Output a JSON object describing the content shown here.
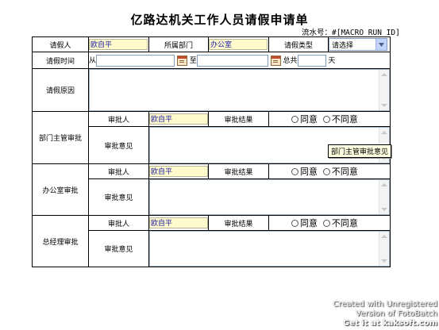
{
  "title": "亿路达机关工作人员请假申请单",
  "serial": {
    "label": "流水号：",
    "value": "#[MACRO_RUN_ID]"
  },
  "row1": {
    "applicant_label": "请假人",
    "applicant_value": "欧自平",
    "dept_label": "所属部门",
    "dept_value": "办公室",
    "type_label": "请假类型",
    "type_select": "请选择"
  },
  "row2": {
    "label": "请假时间",
    "from": "从",
    "to": "至",
    "total": "总共",
    "unit": "天"
  },
  "row3": {
    "label": "请假原因"
  },
  "sections": {
    "dept": {
      "label": "部门主管审批",
      "approver_label": "审批人",
      "approver_value": "欧自平",
      "result_label": "审批结果",
      "agree": "同意",
      "disagree": "不同意",
      "opinion_label": "审批意见"
    },
    "office": {
      "label": "办公室审批",
      "approver_label": "审批人",
      "approver_value": "欧自平",
      "result_label": "审批结果",
      "agree": "同意",
      "disagree": "不同意",
      "opinion_label": "审批意见"
    },
    "gm": {
      "label": "总经理审批",
      "approver_label": "审批人",
      "approver_value": "欧自平",
      "result_label": "审批结果",
      "agree": "同意",
      "disagree": "不同意",
      "opinion_label": "审批意见"
    }
  },
  "tooltip": "部门主管审批意见",
  "watermark": {
    "line1": "Created with Unregistered",
    "line2": "Version of FotoBatch",
    "line3": "Get it at kaksoft.com"
  }
}
